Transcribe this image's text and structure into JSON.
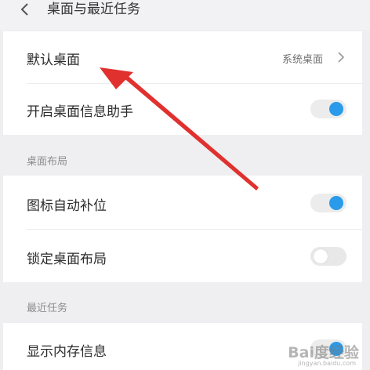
{
  "header": {
    "title": "桌面与最近任务",
    "back_icon": "chevron-left-icon"
  },
  "settings": {
    "default_desktop": {
      "label": "默认桌面",
      "value": "系统桌面",
      "icon": "chevron-right-icon"
    },
    "desktop_assistant": {
      "label": "开启桌面信息助手",
      "enabled": true
    }
  },
  "desktop_layout": {
    "section_title": "桌面布局",
    "auto_fill_icons": {
      "label": "图标自动补位",
      "enabled": true
    },
    "lock_layout": {
      "label": "锁定桌面布局",
      "enabled": false
    }
  },
  "recent_tasks": {
    "section_title": "最近任务",
    "show_memory": {
      "label": "显示内存信息",
      "enabled": true
    }
  },
  "annotation": {
    "arrow_color": "#e0312f"
  },
  "watermark": {
    "text": "Bai度经验",
    "sub": "jingyan.baidu.com"
  },
  "colors": {
    "accent": "#2a9bea",
    "background": "#efeff1"
  }
}
